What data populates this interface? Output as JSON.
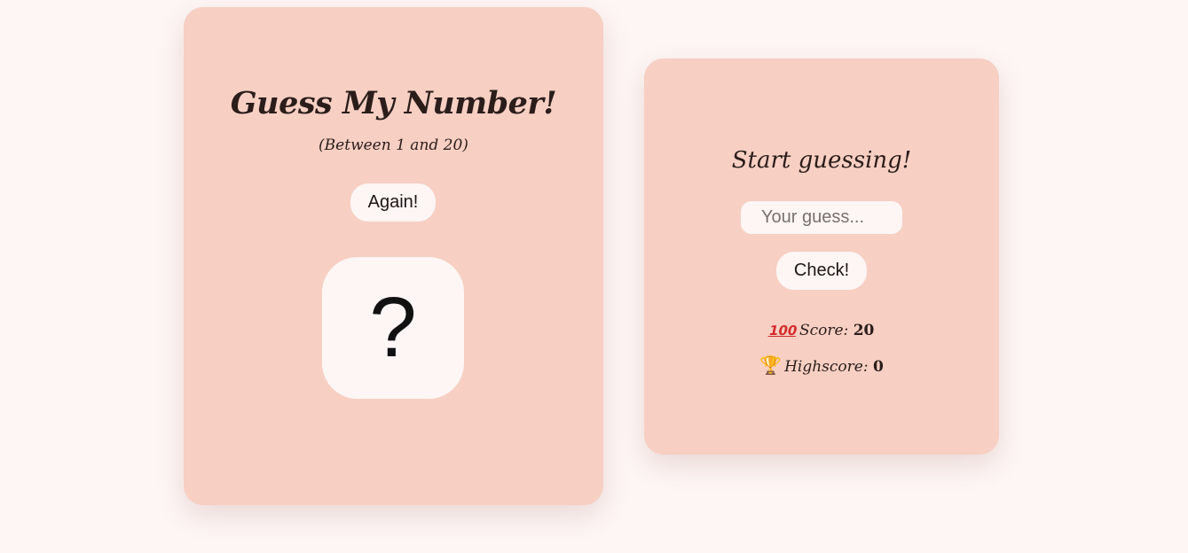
{
  "game": {
    "title": "Guess My Number!",
    "subtitle": "(Between 1 and 20)",
    "again_label": "Again!",
    "secret_display": "?"
  },
  "panel": {
    "message": "Start guessing!",
    "guess_placeholder": "Your guess...",
    "guess_value": "",
    "check_label": "Check!",
    "score": {
      "icon": "hundred-points-icon",
      "icon_glyph": "💯",
      "label": "Score:",
      "value": "20"
    },
    "highscore": {
      "icon": "trophy-icon",
      "icon_glyph": "🏆",
      "label": "Highscore:",
      "value": "0"
    }
  },
  "colors": {
    "background": "#fdf6f5",
    "card": "#f7cfc3",
    "text": "#2b1d1a"
  }
}
